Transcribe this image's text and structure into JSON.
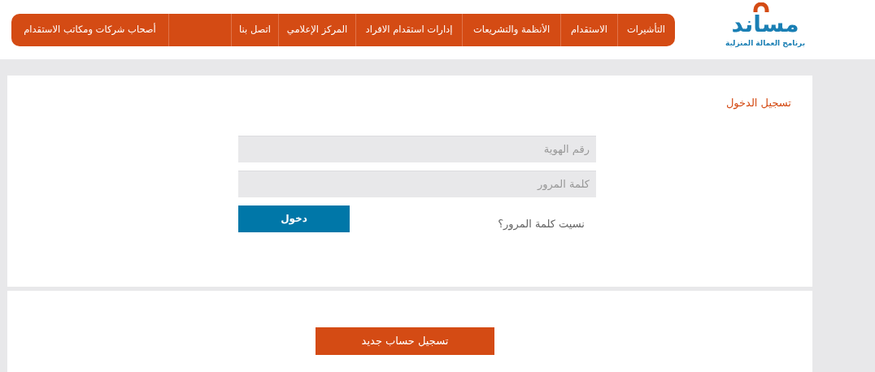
{
  "logo": {
    "name": "مساند",
    "subtitle": "برنامج العمالة المنزلية"
  },
  "nav": [
    {
      "label": "التأشيرات"
    },
    {
      "label": "الاستقدام"
    },
    {
      "label": "الأنظمة والتشريعات"
    },
    {
      "label": "إدارات استقدام الافراد"
    },
    {
      "label": "المركز الإعلامي"
    },
    {
      "label": "اتصل بنا"
    },
    {
      "label": "أصحاب شركات ومكاتب الاستقدام"
    }
  ],
  "login": {
    "title": "تسجيل الدخول",
    "fields": [
      {
        "placeholder": "رقم الهوية"
      },
      {
        "placeholder": "كلمة المرور"
      }
    ],
    "forgot": "نسيت كلمة المرور؟",
    "submit": "دخول"
  },
  "register": {
    "button": "تسجيل حساب جديد"
  }
}
